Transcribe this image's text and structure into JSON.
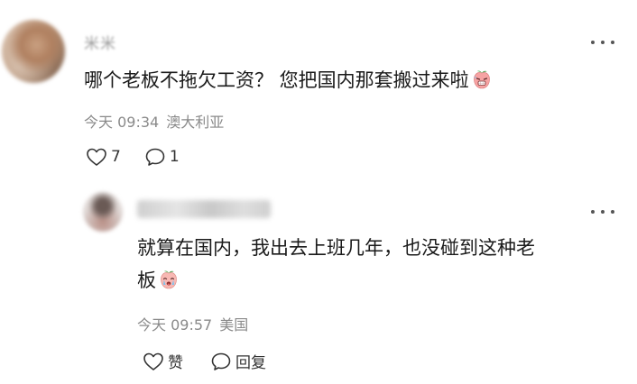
{
  "comment": {
    "author_masked": "米米",
    "text": "哪个老板不拖欠工资？ 您把国内那套搬过来啦",
    "emoji_icon": "sweaty-peach-face-emoji",
    "time": "今天 09:34",
    "location": "澳大利亚",
    "likes": "7",
    "replies": "1"
  },
  "reply": {
    "text_line1": "就算在国内，我出去上班几年，也没碰到这种老",
    "text_line2": "板",
    "emoji_icon": "crying-peach-face-emoji",
    "time": "今天 09:57",
    "location": "美国",
    "like_label": "赞",
    "reply_label": "回复"
  },
  "colors": {
    "text": "#1a1a1a",
    "meta": "#8a8a8a",
    "icon": "#333333"
  }
}
